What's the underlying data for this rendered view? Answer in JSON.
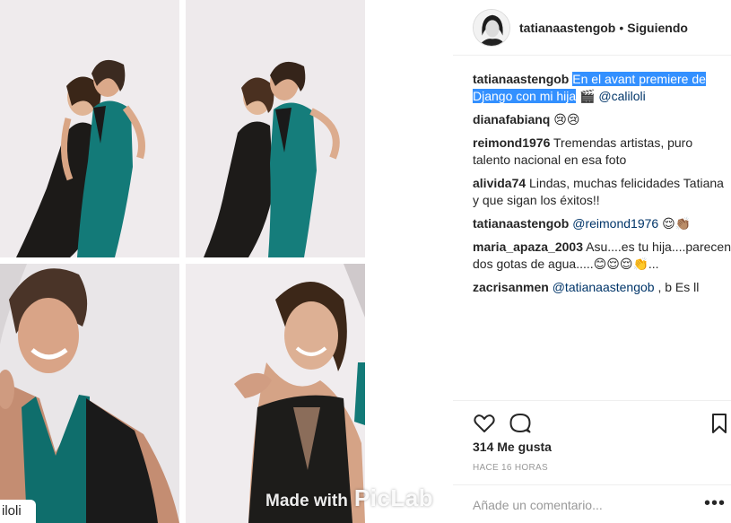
{
  "post": {
    "header": {
      "username": "tatianaastengob",
      "separator": "•",
      "follow_status": "Siguiendo"
    },
    "caption": {
      "username": "tatianaastengob",
      "highlighted_text": "En el avant premiere de Django con mi hija",
      "emoji": "🎬",
      "mention": "@caliloli"
    },
    "comments": [
      {
        "username": "dianafabianq",
        "text": "😢😢"
      },
      {
        "username": "reimond1976",
        "text": "Tremendas artistas, puro talento nacional en esa foto"
      },
      {
        "username": "alivida74",
        "text": "Lindas, muchas felicidades Tatiana y que sigan los éxitos!!"
      },
      {
        "username": "tatianaastengob",
        "mention": "@reimond1976",
        "text": "😌👏🏽"
      },
      {
        "username": "maria_apaza_2003",
        "text": "Asu....es tu hija....parecen dos gotas de agua.....😊😌😌👏..."
      },
      {
        "username": "zacrisanmen",
        "mention": "@tatianaastengob",
        "text": ", b Es ll"
      }
    ],
    "likes_text": "314 Me gusta",
    "time_text": "HACE 16 HORAS",
    "comment_input": {
      "placeholder": "Añade un comentario..."
    },
    "more_label": "•••",
    "icons": [
      "heart-icon",
      "comment-icon",
      "bookmark-icon"
    ]
  },
  "photo": {
    "tag_text": "iloli",
    "watermark_prefix": "Made with",
    "watermark_brand": "PicLab"
  },
  "colors": {
    "selection": "#3390ff",
    "mention": "#003569",
    "meta": "#999999",
    "border": "#efefef"
  }
}
